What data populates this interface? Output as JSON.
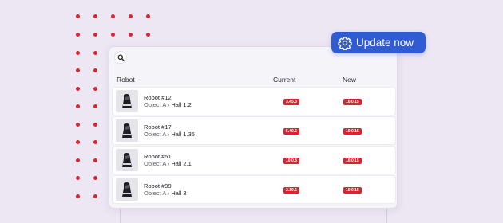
{
  "colors": {
    "accent": "#2f5bd3",
    "badge": "#d62430",
    "dot": "#e0242f",
    "background": "#ede6f3"
  },
  "update_button": {
    "label": "Update now",
    "icon": "gear-icon"
  },
  "search": {
    "icon": "search-icon"
  },
  "table": {
    "headers": {
      "robot": "Robot",
      "current": "Current",
      "new": "New"
    },
    "rows": [
      {
        "name": "Robot #12",
        "object": "Object A",
        "hall": "Hall 1.2",
        "current": "3.45.3",
        "new": "10.0.15"
      },
      {
        "name": "Robot #17",
        "object": "Object A",
        "hall": "Hall 1.35",
        "current": "5.40.6",
        "new": "10.0.15"
      },
      {
        "name": "Robot #51",
        "object": "Object A",
        "hall": "Hall 2.1",
        "current": "10.0.8",
        "new": "10.0.15"
      },
      {
        "name": "Robot #99",
        "object": "Object A",
        "hall": "Hall 3",
        "current": "2.19.6",
        "new": "10.0.15"
      }
    ]
  }
}
